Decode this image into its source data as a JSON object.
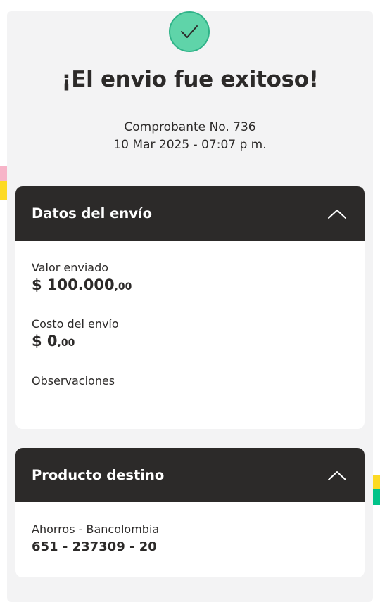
{
  "header": {
    "status_icon": "check-icon",
    "title": "¡El envio fue exitoso!",
    "receipt_number": "Comprobante No. 736",
    "receipt_date": "10 Mar 2025 - 07:07 p m."
  },
  "shipment_details": {
    "title": "Datos del envío",
    "toggle_icon": "chevron-up-icon",
    "amount_sent": {
      "label": "Valor enviado",
      "main": "$ 100.000",
      "cents": ",00"
    },
    "shipping_cost": {
      "label": "Costo del envío",
      "main": "$ 0",
      "cents": ",00"
    },
    "notes": {
      "label": "Observaciones",
      "value": ""
    }
  },
  "destination_product": {
    "title": "Producto destino",
    "toggle_icon": "chevron-up-icon",
    "account_label": "Ahorros - Bancolombia",
    "account_number": "651 - 237309 - 20"
  },
  "colors": {
    "dark_header": "#2c2a29",
    "success_green": "#5fd4a9",
    "background": "#f3f3f4",
    "accent_yellow": "#fdda24",
    "accent_pink": "#f7b4c8",
    "accent_green": "#00c389"
  }
}
